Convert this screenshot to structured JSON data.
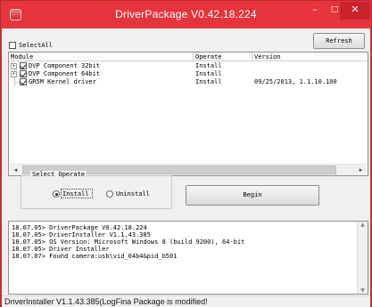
{
  "window": {
    "title": "DriverPackage V0.42.18.224",
    "controls": {
      "minimize": "–",
      "maximize": "□",
      "close": "✕"
    }
  },
  "toolbar": {
    "select_all_label": "SelectAll",
    "select_all_checked": false,
    "refresh_label": "Refresh"
  },
  "table": {
    "columns": [
      "Module",
      "Operate",
      "Version"
    ],
    "rows": [
      {
        "expander": "+",
        "checked": true,
        "module": "DVP Component 32bit",
        "operate": "Install",
        "version": ""
      },
      {
        "expander": "+",
        "checked": true,
        "module": "DVP Component 64bit",
        "operate": "Install",
        "version": ""
      },
      {
        "expander": "",
        "checked": true,
        "module": "GR5M Kernel driver",
        "operate": "Install",
        "version": "09/25/2013, 1.1.10.100"
      }
    ]
  },
  "select_operate": {
    "title": "Select Operate",
    "options": [
      "Install",
      "Uninstall"
    ],
    "selected": "Install"
  },
  "begin_label": "Begin",
  "log": [
    "18.07.05> DriverPackage V0.42.18.224",
    "18.07.05> DriverInstaller V1.1.43.385",
    "18.07.05> OS Version: Microsoft Windows 8  (build 9200), 64-bit",
    "18.07.05> Driver Installer",
    "18.07.07> Found camera:usb\\vid_04b4&pid_b501"
  ],
  "status": "DriverInstaller V1.1.43.385(LogFina Package is modified!"
}
